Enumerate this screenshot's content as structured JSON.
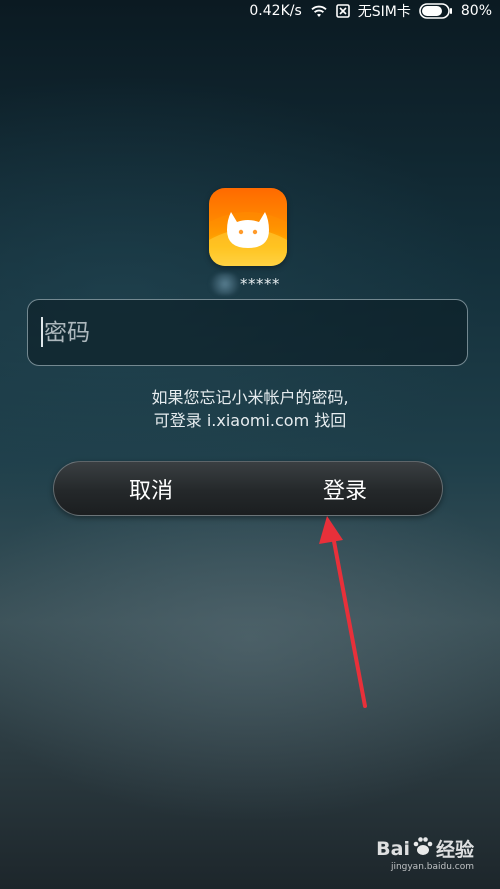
{
  "status_bar": {
    "network_speed": "0.42K/s",
    "sim_status": "无SIM卡",
    "battery_percent": "80%",
    "battery_level": 0.8
  },
  "account": {
    "masked_id": "*****"
  },
  "password_field": {
    "value": "",
    "placeholder": "密码"
  },
  "hint": {
    "line1": "如果您忘记小米帐户的密码,",
    "line2": "可登录 i.xiaomi.com 找回"
  },
  "buttons": {
    "cancel_label": "取消",
    "login_label": "登录"
  },
  "watermark": {
    "brand_left": "Bai",
    "brand_right": "经验",
    "url": "jingyan.baidu.com"
  },
  "colors": {
    "annotation_arrow": "#e8303a",
    "app_icon_top": "#ff6a00",
    "app_icon_bottom": "#ffd34a"
  },
  "icons": {
    "wifi": "wifi-icon",
    "no_sim": "no-sim-icon",
    "battery": "battery-icon",
    "app": "mi-bunny-icon",
    "paw": "paw-icon"
  }
}
